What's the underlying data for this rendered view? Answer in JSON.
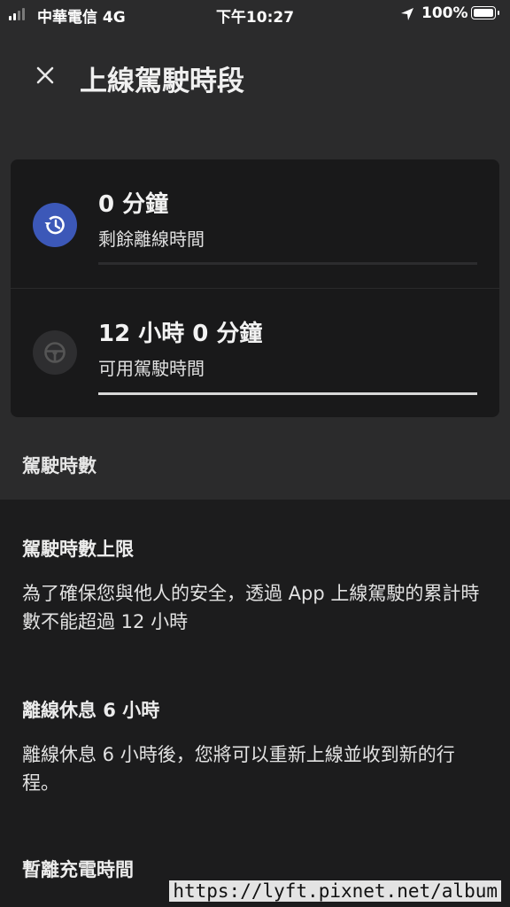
{
  "status_bar": {
    "carrier": "中華電信  4G",
    "time": "下午10:27",
    "battery": "100%"
  },
  "header": {
    "title": "上線駕駛時段"
  },
  "card": {
    "offline": {
      "value": "0 分鐘",
      "label": "剩餘離線時間",
      "progress": 0
    },
    "driving": {
      "value": "12 小時 0 分鐘",
      "label": "可用駕駛時間",
      "progress": 1
    }
  },
  "section_title": "駕駛時數",
  "info": [
    {
      "title": "駕駛時數上限",
      "text": "為了確保您與他人的安全，透過 App 上線駕駛的累計時數不能超過 12 小時"
    },
    {
      "title": "離線休息 6 小時",
      "text": "離線休息 6 小時後，您將可以重新上線並收到新的行程。"
    },
    {
      "title": "暫離充電時間",
      "text": ""
    }
  ],
  "watermark": "https://lyft.pixnet.net/album",
  "colors": {
    "accent": "#3c58b8",
    "background": "#1c1c1d",
    "header_bg": "#2b2b2c"
  }
}
